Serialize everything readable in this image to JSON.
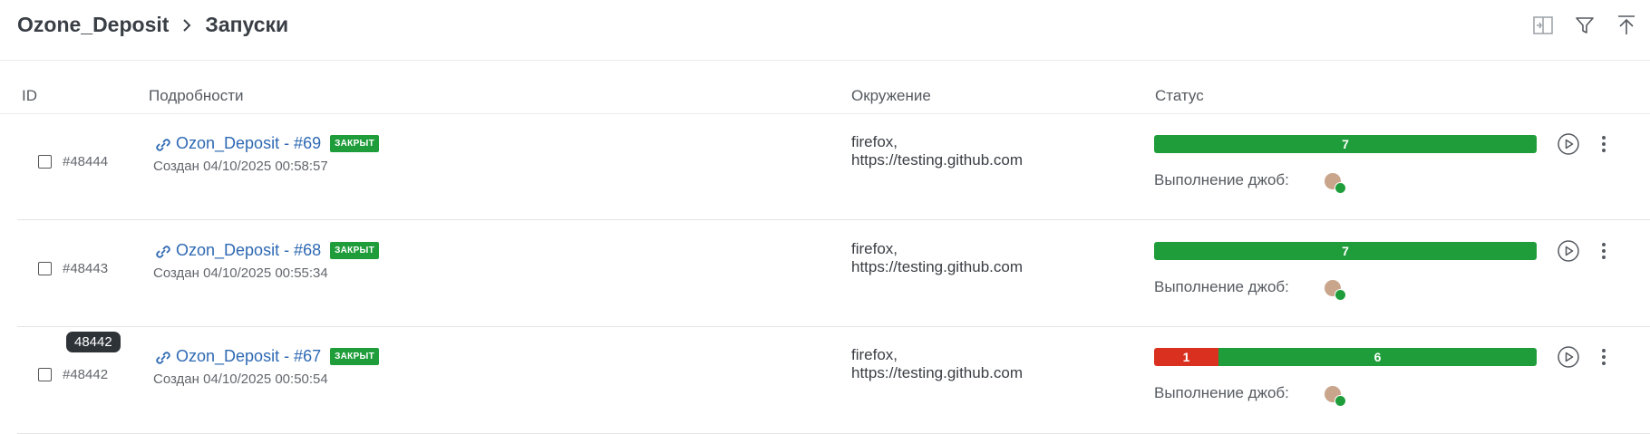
{
  "breadcrumb": {
    "project": "Ozone_Deposit",
    "page": "Запуски"
  },
  "toolbar": {
    "icons": [
      "compare-icon",
      "filter-icon",
      "scroll-top-icon"
    ]
  },
  "table": {
    "columns": {
      "id": "ID",
      "details": "Подробности",
      "env": "Окружение",
      "status": "Статус"
    },
    "jobs_label": "Выполнение джоб:",
    "rows": [
      {
        "id": "#48444",
        "title": "Ozon_Deposit - #69",
        "badge": "ЗАКРЫТ",
        "created": "Создан 04/10/2025 00:58:57",
        "env_line1": "firefox,",
        "env_line2": "https://testing.github.com",
        "failed": null,
        "passed": "7"
      },
      {
        "id": "#48443",
        "title": "Ozon_Deposit - #68",
        "badge": "ЗАКРЫТ",
        "created": "Создан 04/10/2025 00:55:34",
        "env_line1": "firefox,",
        "env_line2": "https://testing.github.com",
        "failed": null,
        "passed": "7"
      },
      {
        "id": "#48442",
        "title": "Ozon_Deposit - #67",
        "badge": "ЗАКРЫТ",
        "created": "Создан 04/10/2025 00:50:54",
        "env_line1": "firefox,",
        "env_line2": "https://testing.github.com",
        "failed": "1",
        "passed": "6"
      }
    ]
  },
  "tooltip": {
    "text": "48442"
  },
  "colors": {
    "pass": "#1f9d3b",
    "fail": "#d9301f",
    "link": "#2e69b3"
  }
}
